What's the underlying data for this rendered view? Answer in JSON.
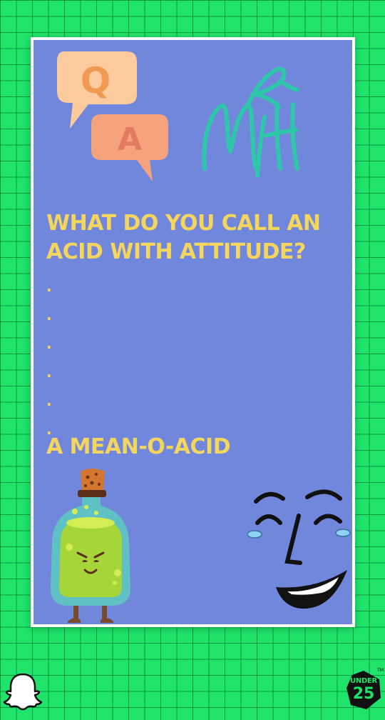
{
  "story": {
    "qa_badge": {
      "letter_q": "Q",
      "letter_a": "A",
      "bubble_q_color": "#fbcb9e",
      "bubble_a_color": "#f6a27d",
      "letter_q_color": "#f09a52",
      "letter_a_color": "#e37a62"
    },
    "signature_icon": "mrh-signature-logo",
    "question": "WHAT DO YOU CALL AN ACID WITH ATTITUDE?",
    "dots": [
      ".",
      ".",
      ".",
      ".",
      ".",
      "."
    ],
    "answer": "A MEAN-O-ACID",
    "bottle_icon": "angry-potion-bottle",
    "face_icon": "laughing-face"
  },
  "footer": {
    "snapchat_icon": "snapchat-ghost-icon",
    "under25": {
      "top": "UNDER",
      "number": "25",
      "tm": "TM"
    }
  },
  "colors": {
    "background": "#1fe36a",
    "card": "#7087dc",
    "card_border": "#ffffff",
    "text_accent": "#f4d55e",
    "signature": "#2ec7a9"
  }
}
